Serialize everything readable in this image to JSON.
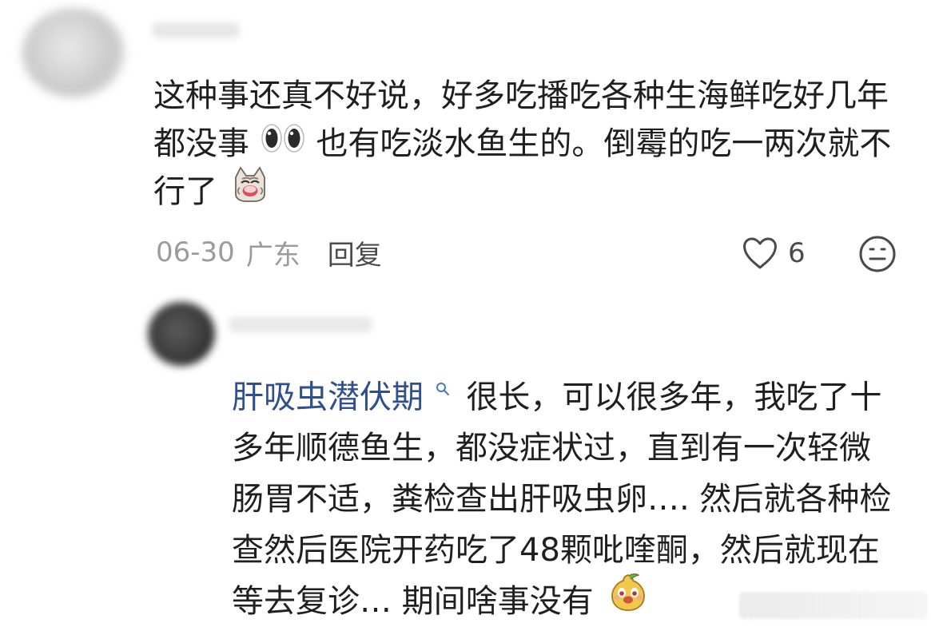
{
  "comment_1": {
    "text_part_1": "这种事还真不好说，好多吃播吃各种生海鲜吃好几年都没事",
    "text_part_2": "也有吃淡水鱼生的。倒霉的吃一两次就不行了",
    "date": "06-30",
    "region": "广东",
    "reply_label": "回复",
    "like_count": "6",
    "icons": [
      "heart-icon",
      "meh-face-icon",
      "eyes-emoji-icon",
      "crying-cat-emoji-icon"
    ]
  },
  "comment_2": {
    "keyword": "肝吸虫潜伏期",
    "text_part_1": "很长，可以很多年，我吃了十多年顺德鱼生，都没症状过，直到有一次轻微肠胃不适，粪检查出肝吸虫卵…. 然后就各种检查然后医院开药吃了48颗吡喹酮，然后就现在等去复诊… 期间啥事没有",
    "icons": [
      "search-icon",
      "pear-face-emoji-icon"
    ]
  },
  "colors": {
    "text": "#1f1f1f",
    "meta": "#9b9b9b",
    "keyword": "#2f4f8f",
    "icon": "#4a4a4a"
  }
}
